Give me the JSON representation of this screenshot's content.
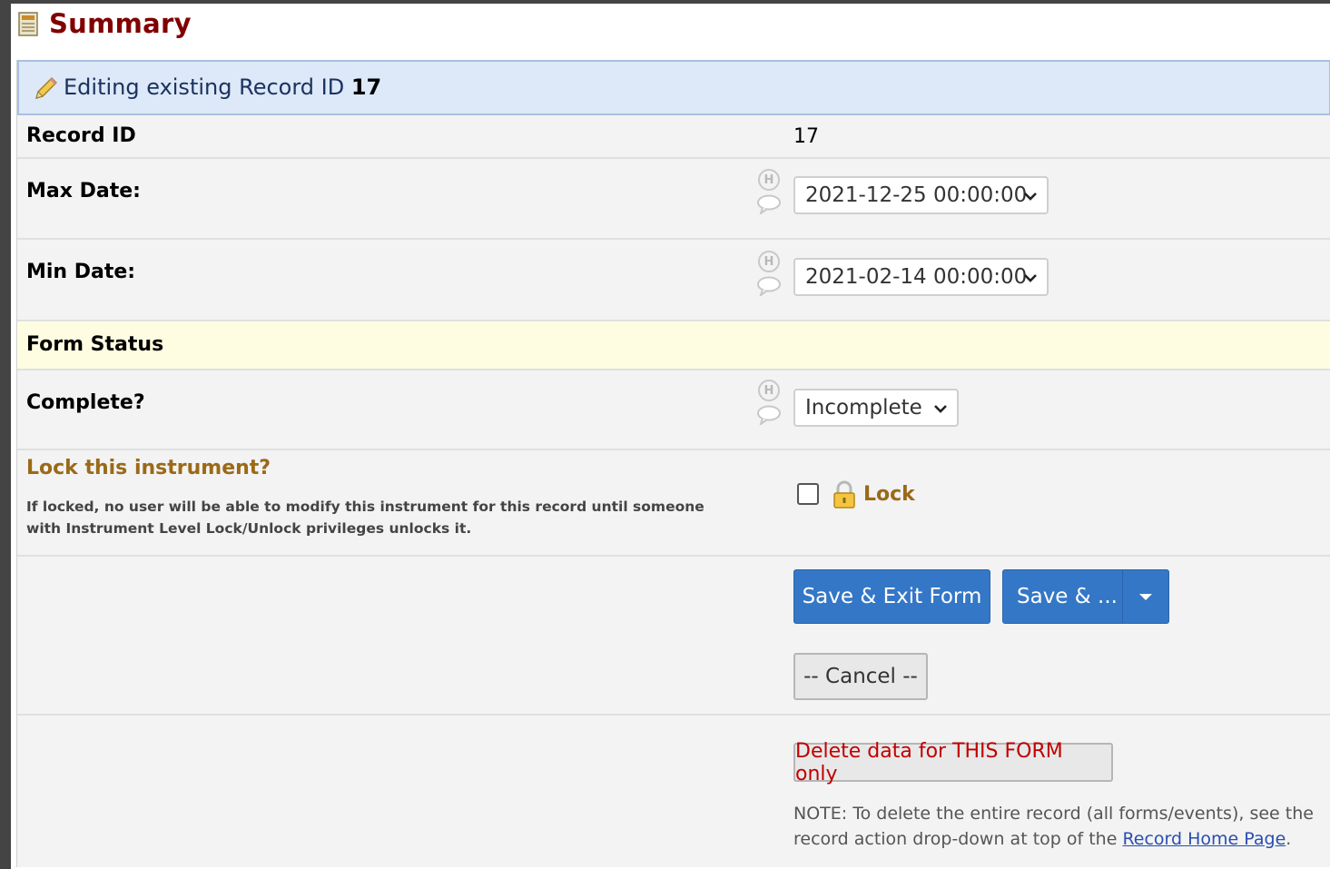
{
  "header": {
    "title": "Summary",
    "icon": "form-icon"
  },
  "editing": {
    "prefix": "Editing existing Record ID",
    "record_id": "17"
  },
  "fields": {
    "record_id": {
      "label": "Record ID",
      "value": "17"
    },
    "max_date": {
      "label": "Max Date:",
      "value": "2021-12-25 00:00:00"
    },
    "min_date": {
      "label": "Min Date:",
      "value": "2021-02-14 00:00:00"
    }
  },
  "form_status": {
    "section_label": "Form Status",
    "complete_label": "Complete?",
    "complete_value": "Incomplete"
  },
  "lock": {
    "title": "Lock this instrument?",
    "note": "If locked, no user will be able to modify this instrument for this record until someone with Instrument Level Lock/Unlock privileges unlocks it.",
    "label": "Lock",
    "checked": false
  },
  "buttons": {
    "save_exit": "Save & Exit Form",
    "save_more": "Save & ...",
    "cancel": "-- Cancel --",
    "delete": "Delete data for THIS FORM only"
  },
  "delete_note": {
    "text": "NOTE: To delete the entire record (all forms/events), see the record action drop-down at top of the",
    "link": "Record Home Page",
    "suffix": "."
  },
  "colors": {
    "title": "#800000",
    "primary_button": "#3477c7",
    "lock_text": "#9a6a18",
    "delete_text": "#c00000",
    "editing_bg": "#dde8f8",
    "form_status_bg": "#fefde1"
  },
  "icons": [
    "form-icon",
    "pencil-icon",
    "history-icon",
    "comment-icon",
    "chevron-down-icon",
    "padlock-icon",
    "caret-down-icon"
  ]
}
